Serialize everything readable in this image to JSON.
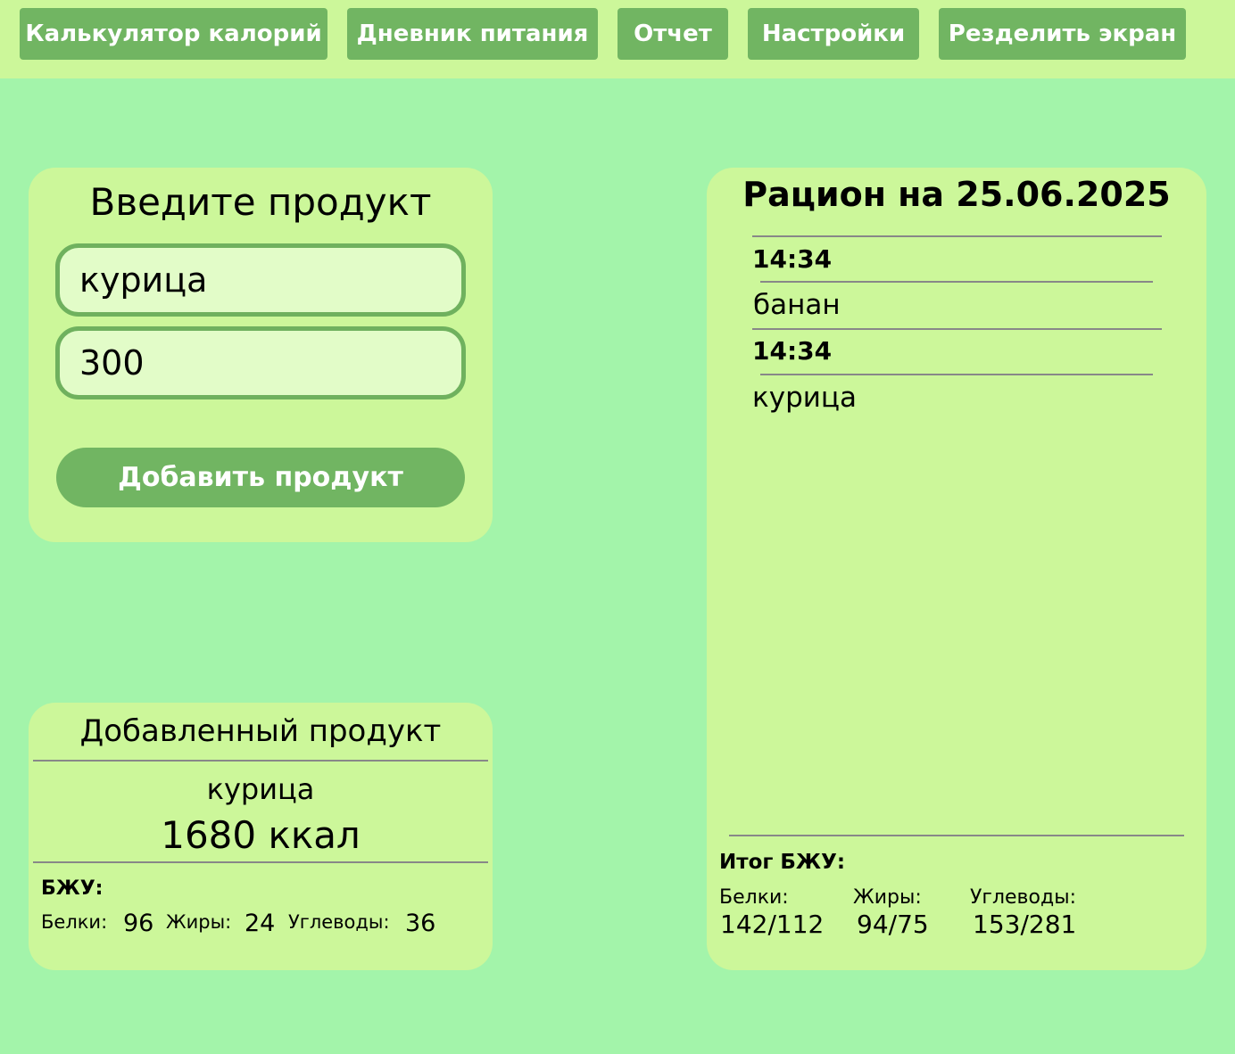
{
  "nav": {
    "items": [
      {
        "label": "Калькулятор калорий"
      },
      {
        "label": "Дневник питания"
      },
      {
        "label": "Отчет"
      },
      {
        "label": "Настройки"
      },
      {
        "label": "Резделить экран"
      }
    ]
  },
  "input_card": {
    "title": "Введите продукт",
    "product_value": "курица",
    "amount_value": "300",
    "add_button_label": "Добавить продукт"
  },
  "added_card": {
    "title": "Добавленный продукт",
    "product_name": "курица",
    "calories": "1680 ккал",
    "bju_label": "БЖУ:",
    "proteins_label": "Белки:",
    "proteins_value": "96",
    "fats_label": "Жиры:",
    "fats_value": "24",
    "carbs_label": "Углеводы:",
    "carbs_value": "36"
  },
  "ration_card": {
    "title": "Рацион на 25.06.2025",
    "entries": [
      {
        "time": "14:34",
        "product": "банан"
      },
      {
        "time": "14:34",
        "product": "курица"
      }
    ],
    "total_label": "Итог БЖУ:",
    "proteins_label": "Белки:",
    "proteins_value": "142/112",
    "fats_label": "Жиры:",
    "fats_value": "94/75",
    "carbs_label": "Углеводы:",
    "carbs_value": "153/281"
  },
  "colors": {
    "background": "#a3f4aa",
    "topbar": "#ccf79a",
    "card": "#ccf79a",
    "accent": "#71b562",
    "field_bg": "#e2fcc8"
  }
}
